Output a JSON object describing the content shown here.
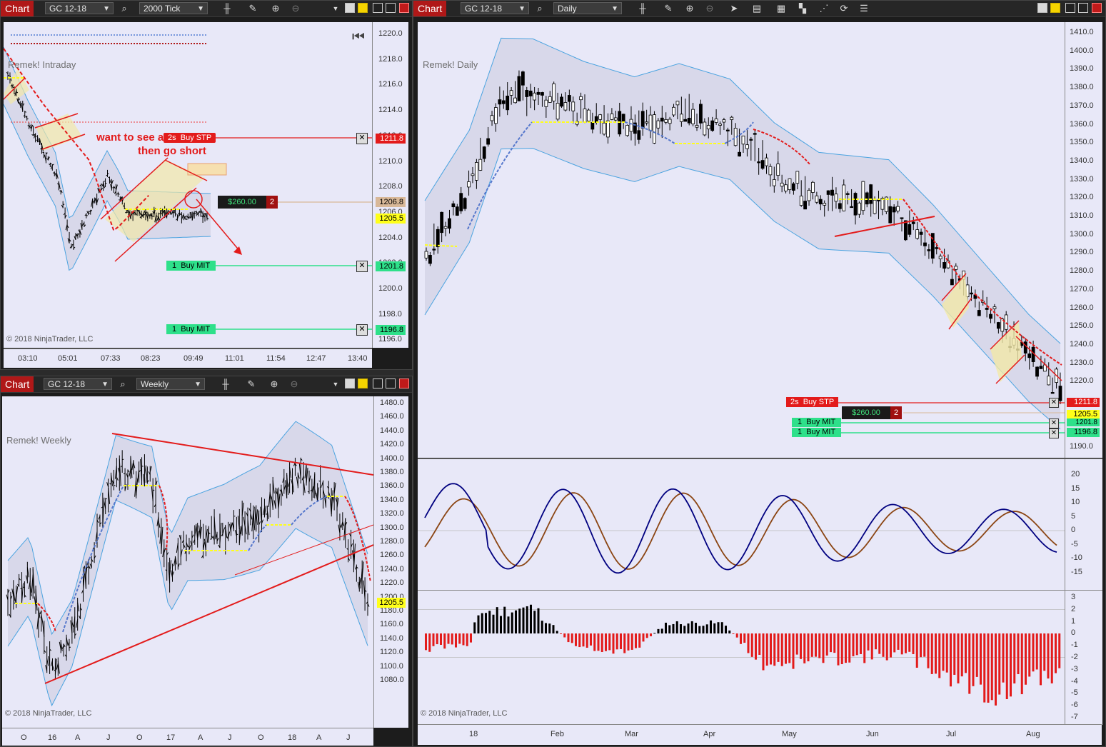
{
  "toolbar_title": "Chart",
  "windows": {
    "intraday": {
      "instrument": "GC 12-18",
      "period": "2000 Tick",
      "watermark": "Remek! Intraday",
      "copyright": "© 2018 NinjaTrader, LLC",
      "y_ticks": [
        "1220.0",
        "1218.0",
        "1216.0",
        "1214.0",
        "1212.0",
        "1210.0",
        "1208.0",
        "1206.0",
        "1204.0",
        "1202.0",
        "1200.0",
        "1198.0",
        "1196.0"
      ],
      "x_ticks": [
        "03:10",
        "05:01",
        "07:33",
        "08:23",
        "09:49",
        "11:01",
        "11:54",
        "12:47",
        "13:40"
      ],
      "annotation_line1": "want to see a breakout",
      "annotation_line2": "then go short",
      "orders": [
        {
          "qty": "2s",
          "label": "Buy STP",
          "price": "1211.8",
          "color": "#e31b1b"
        },
        {
          "qty": "1",
          "label": "Buy MIT",
          "price": "1201.8",
          "color": "#2ee08a"
        },
        {
          "qty": "1",
          "label": "Buy MIT",
          "price": "1196.8",
          "color": "#2ee08a"
        }
      ],
      "pnl": "$260.00",
      "pnl_qty": "2",
      "avg_price": "1206.8",
      "last_price": "1205.5"
    },
    "weekly": {
      "instrument": "GC 12-18",
      "period": "Weekly",
      "watermark": "Remek! Weekly",
      "copyright": "© 2018 NinjaTrader, LLC",
      "y_ticks": [
        "1480.0",
        "1460.0",
        "1440.0",
        "1420.0",
        "1400.0",
        "1380.0",
        "1360.0",
        "1340.0",
        "1320.0",
        "1300.0",
        "1280.0",
        "1260.0",
        "1240.0",
        "1220.0",
        "1200.0",
        "1180.0",
        "1160.0",
        "1140.0",
        "1120.0",
        "1100.0",
        "1080.0"
      ],
      "x_ticks": [
        "O",
        "16",
        "A",
        "J",
        "O",
        "17",
        "A",
        "J",
        "O",
        "18",
        "A",
        "J"
      ],
      "last_price": "1205.5"
    },
    "daily": {
      "instrument": "GC 12-18",
      "period": "Daily",
      "watermark": "Remek! Daily",
      "copyright": "© 2018 NinjaTrader, LLC",
      "y_ticks": [
        "1410.0",
        "1400.0",
        "1390.0",
        "1380.0",
        "1370.0",
        "1360.0",
        "1350.0",
        "1340.0",
        "1330.0",
        "1320.0",
        "1310.0",
        "1300.0",
        "1290.0",
        "1280.0",
        "1270.0",
        "1260.0",
        "1250.0",
        "1240.0",
        "1230.0",
        "1220.0",
        "1190.0"
      ],
      "osc_ticks": [
        "20",
        "15",
        "10",
        "5",
        "0",
        "-5",
        "-10",
        "-15"
      ],
      "hist_ticks": [
        "3",
        "2",
        "1",
        "0",
        "-1",
        "-2",
        "-3",
        "-4",
        "-5",
        "-6",
        "-7"
      ],
      "x_ticks": [
        "18",
        "Feb",
        "Mar",
        "Apr",
        "May",
        "Jun",
        "Jul",
        "Aug"
      ],
      "orders": [
        {
          "qty": "2s",
          "label": "Buy STP",
          "price": "1211.8",
          "color": "#e31b1b"
        },
        {
          "qty": "1",
          "label": "Buy MIT",
          "price": "1201.8",
          "color": "#2ee08a"
        },
        {
          "qty": "1",
          "label": "Buy MIT",
          "price": "1196.8",
          "color": "#2ee08a"
        }
      ],
      "pnl": "$260.00",
      "pnl_qty": "2",
      "last_price": "1205.5"
    }
  },
  "colors": {
    "chart_bg": "#e8e8f8",
    "band_fill": "#d8d8ea",
    "band_line": "#4aa3e0",
    "stop_red": "#e31b1b",
    "mit_green": "#2ee08a",
    "last_yellow": "#ffff1a",
    "avg_tan": "#d8b898",
    "osc_fast": "#000080",
    "osc_slow": "#8b4513"
  }
}
